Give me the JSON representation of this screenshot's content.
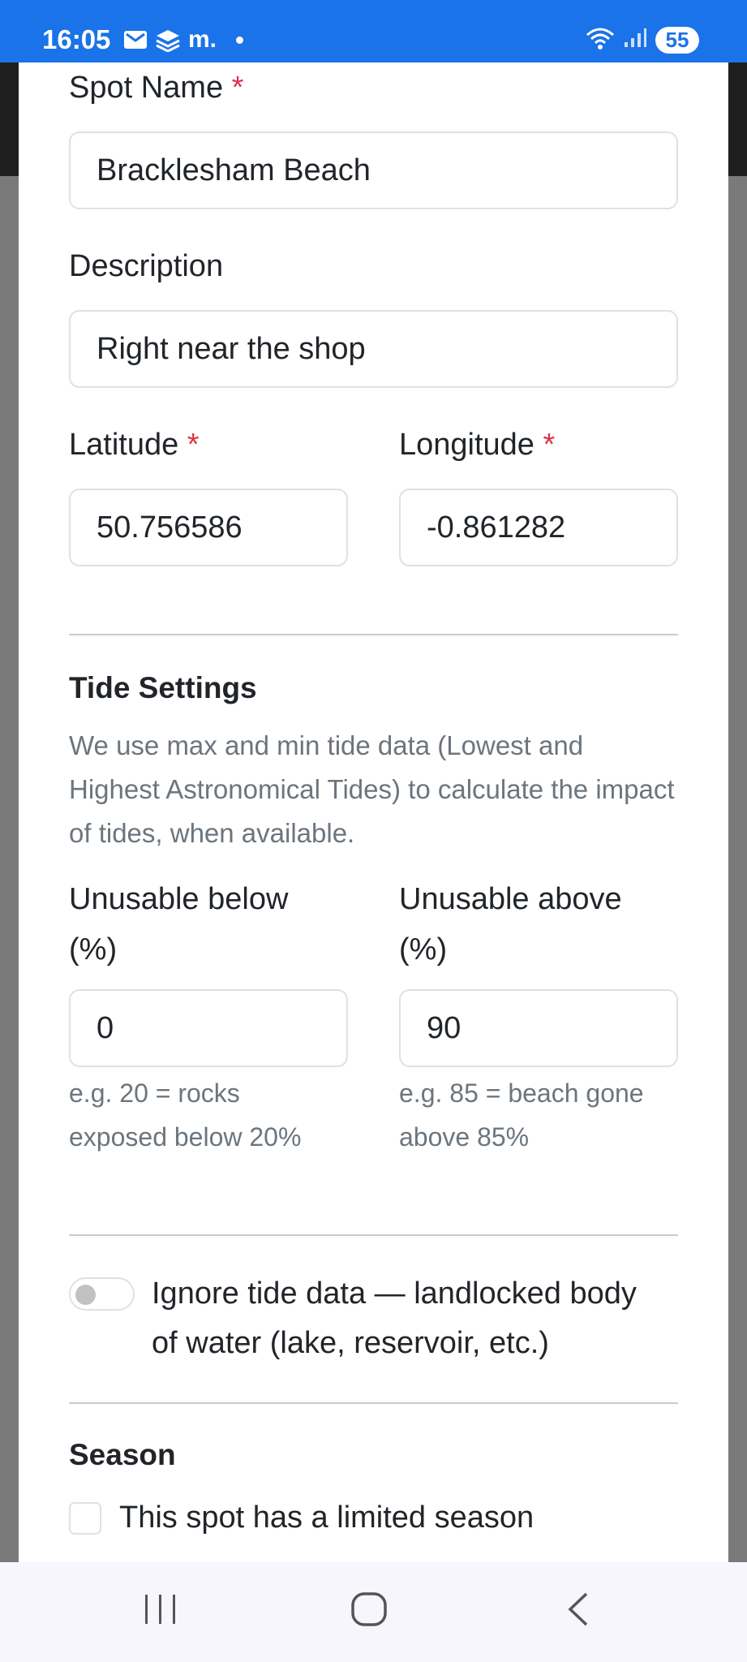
{
  "status_bar": {
    "time": "16:05",
    "notif_m": "m.",
    "battery": "55",
    "accent_color": "#1a73e8",
    "icons": [
      "mail-icon",
      "stack-icon",
      "wifi-icon",
      "signal-icon"
    ]
  },
  "form": {
    "spot_name": {
      "label": "Spot Name",
      "required_mark": "*",
      "value": "Bracklesham Beach"
    },
    "description": {
      "label": "Description",
      "value": "Right near the shop"
    },
    "latitude": {
      "label": "Latitude",
      "required_mark": "*",
      "value": "50.756586"
    },
    "longitude": {
      "label": "Longitude",
      "required_mark": "*",
      "value": "-0.861282"
    }
  },
  "tide_settings": {
    "title": "Tide Settings",
    "info": "We use max and min tide data (Lowest and Highest Astronomical Tides) to calculate the impact of tides, when available.",
    "unusable_below": {
      "label_line1": "Unusable below",
      "label_line2": "(%)",
      "value": "0",
      "help_line1": "e.g. 20 = rocks",
      "help_line2": "exposed below 20%"
    },
    "unusable_above": {
      "label_line1": "Unusable above",
      "label_line2": "(%)",
      "value": "90",
      "help_line1": "e.g. 85 = beach gone",
      "help_line2": "above 85%"
    },
    "ignore_tide": {
      "line1": "Ignore tide data — landlocked body",
      "line2": "of water (lake, reservoir, etc.)",
      "checked": false
    }
  },
  "season": {
    "title": "Season",
    "limited_season_label": "This spot has a limited season",
    "checked": false
  },
  "nav_bar": {
    "icons": [
      "recent-apps-icon",
      "home-icon",
      "back-icon"
    ]
  }
}
